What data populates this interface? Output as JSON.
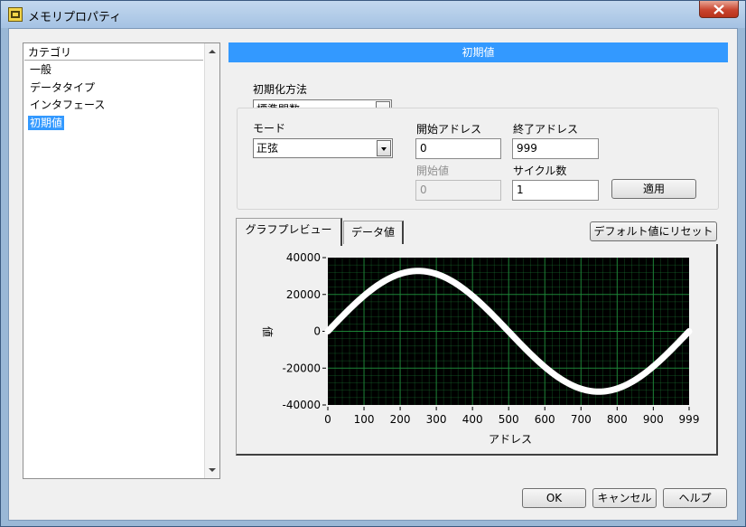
{
  "window": {
    "title": "メモリプロパティ",
    "close_icon": "close-icon"
  },
  "category": {
    "header": "カテゴリ",
    "items": [
      {
        "label": "一般",
        "selected": false
      },
      {
        "label": "データタイプ",
        "selected": false
      },
      {
        "label": "インタフェース",
        "selected": false
      },
      {
        "label": "初期値",
        "selected": true
      }
    ]
  },
  "section": {
    "title": "初期値"
  },
  "init_method": {
    "label": "初期化方法",
    "value": "標準関数"
  },
  "mode": {
    "label": "モード",
    "value": "正弦"
  },
  "start_address": {
    "label": "開始アドレス",
    "value": "0"
  },
  "end_address": {
    "label": "終了アドレス",
    "value": "999"
  },
  "start_value": {
    "label": "開始値",
    "value": "0",
    "disabled": true
  },
  "cycles": {
    "label": "サイクル数",
    "value": "1"
  },
  "apply_button": {
    "label": "適用"
  },
  "tabs": [
    {
      "label": "グラフプレビュー",
      "active": true
    },
    {
      "label": "データ値",
      "active": false
    }
  ],
  "reset_button": {
    "label": "デフォルト値にリセット"
  },
  "footer": {
    "ok": "OK",
    "cancel": "キャンセル",
    "help": "ヘルプ"
  },
  "colors": {
    "accent": "#3399ff",
    "plot_bg": "#000000",
    "grid": "#1f8a3a",
    "trace": "#ffffff"
  },
  "chart_data": {
    "type": "line",
    "xlabel": "アドレス",
    "ylabel": "値",
    "xlim": [
      0,
      999
    ],
    "ylim": [
      -40000,
      40000
    ],
    "xticks": [
      "0",
      "100",
      "200",
      "300",
      "400",
      "500",
      "600",
      "700",
      "800",
      "900",
      "999"
    ],
    "yticks": [
      "40000",
      "20000",
      "0",
      "-20000",
      "-40000"
    ],
    "grid": true,
    "series": [
      {
        "x": [
          0,
          50,
          100,
          150,
          200,
          250,
          300,
          350,
          400,
          450,
          500,
          550,
          600,
          650,
          700,
          750,
          800,
          850,
          900,
          950,
          999
        ],
        "y": [
          0,
          10125,
          19260,
          26510,
          31163,
          32767,
          31163,
          26510,
          19260,
          10125,
          0,
          -10125,
          -19260,
          -26510,
          -31163,
          -32767,
          -31163,
          -26510,
          -19260,
          -10125,
          0
        ]
      }
    ]
  }
}
